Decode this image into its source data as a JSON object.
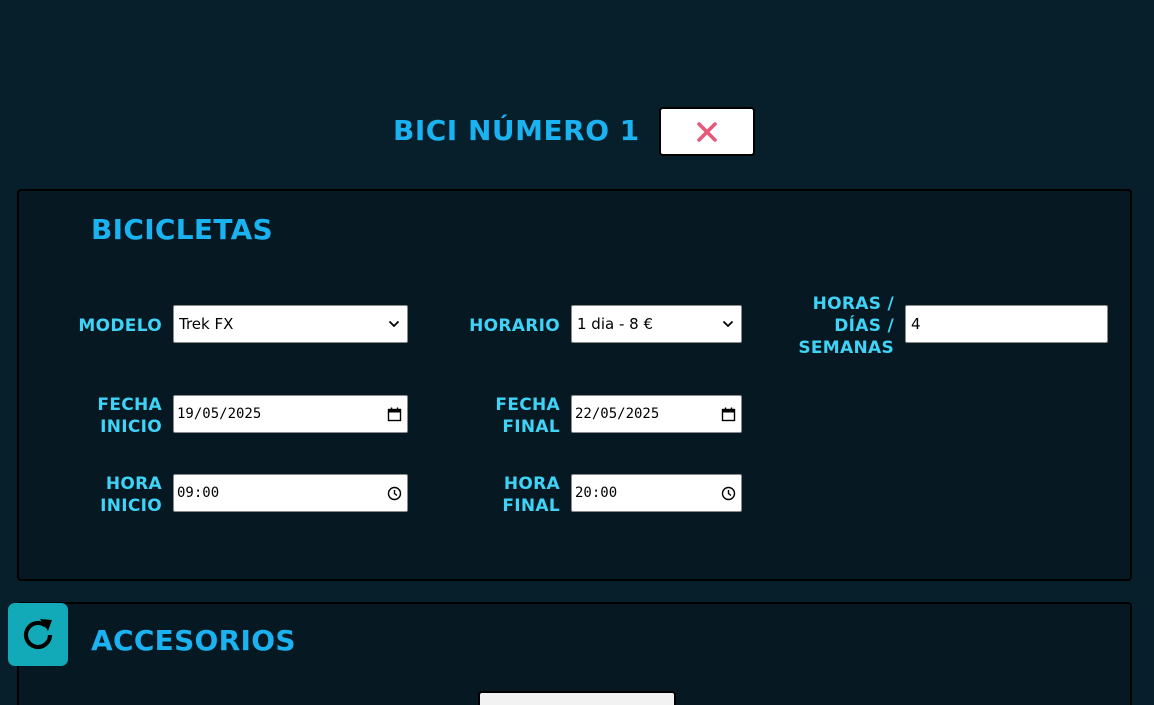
{
  "header": {
    "bike_title": "BICI NÚMERO 1",
    "close_icon": "close-x-icon",
    "close_color": "#e8587a"
  },
  "bikes_section": {
    "title": "BICICLETAS",
    "model": {
      "label": "MODELO",
      "value": "Trek FX"
    },
    "schedule": {
      "label": "HORARIO",
      "value": "1 dia - 8 €"
    },
    "quantity": {
      "label_lines": [
        "HORAS /",
        "DÍAS /",
        "SEMANAS"
      ],
      "value": "4"
    },
    "start_date": {
      "label_lines": [
        "FECHA",
        "INICIO"
      ],
      "value": "19/05/2025"
    },
    "end_date": {
      "label_lines": [
        "FECHA",
        "FINAL"
      ],
      "value": "22/05/2025"
    },
    "start_time": {
      "label_lines": [
        "HORA",
        "INICIO"
      ],
      "value": "09:00"
    },
    "end_time": {
      "label_lines": [
        "HORA",
        "FINAL"
      ],
      "value": "20:00"
    }
  },
  "accessories_section": {
    "title": "ACCESORIOS"
  },
  "refresh_icon": "refresh-icon",
  "colors": {
    "background": "#071f2b",
    "panel": "#061821",
    "title": "#1ab2f0",
    "label": "#3fd3f7",
    "refresh_button": "#12aab8"
  }
}
